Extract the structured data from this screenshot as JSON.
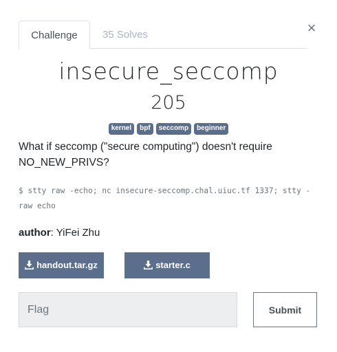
{
  "tabs": {
    "challenge": "Challenge",
    "solves": "35 Solves"
  },
  "close": "×",
  "challenge": {
    "name": "insecure_seccomp",
    "points": "205",
    "tags": [
      "kernel",
      "bpf",
      "seccomp",
      "beginner"
    ],
    "description": "What if seccomp (\"secure computing\") doesn't require NO_NEW_PRIVS?",
    "command": "$ stty raw -echo; nc insecure-seccomp.chal.uiuc.tf 1337; stty -raw echo",
    "author_label": "author",
    "author_name": ": YiFei Zhu"
  },
  "files": [
    {
      "label": "handout.tar.gz",
      "icon": "download-icon"
    },
    {
      "label": "starter.c",
      "icon": "download-icon"
    }
  ],
  "flag": {
    "placeholder": "Flag",
    "submit_label": "Submit"
  },
  "colors": {
    "tag_bg": "#5b6f8d",
    "button_bg": "#5b6f8d"
  }
}
